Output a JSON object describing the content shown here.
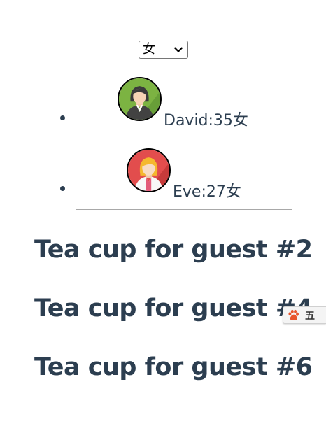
{
  "gender_filter": {
    "selected": "女"
  },
  "people": [
    {
      "name": "David",
      "age": "35",
      "gender": "女",
      "label": "David:35女",
      "avatar_color": "#7cb342"
    },
    {
      "name": "Eve",
      "age": "27",
      "gender": "女",
      "label": "Eve:27女",
      "avatar_color": "#e24d4d"
    }
  ],
  "headings": [
    "Tea cup for guest #2",
    "Tea cup for guest #4",
    "Tea cup for guest #6"
  ],
  "ime": {
    "label": "五",
    "icon": "baidu-paw-icon"
  },
  "colors": {
    "text": "#2c3e50",
    "divider": "#a8a8a8"
  }
}
